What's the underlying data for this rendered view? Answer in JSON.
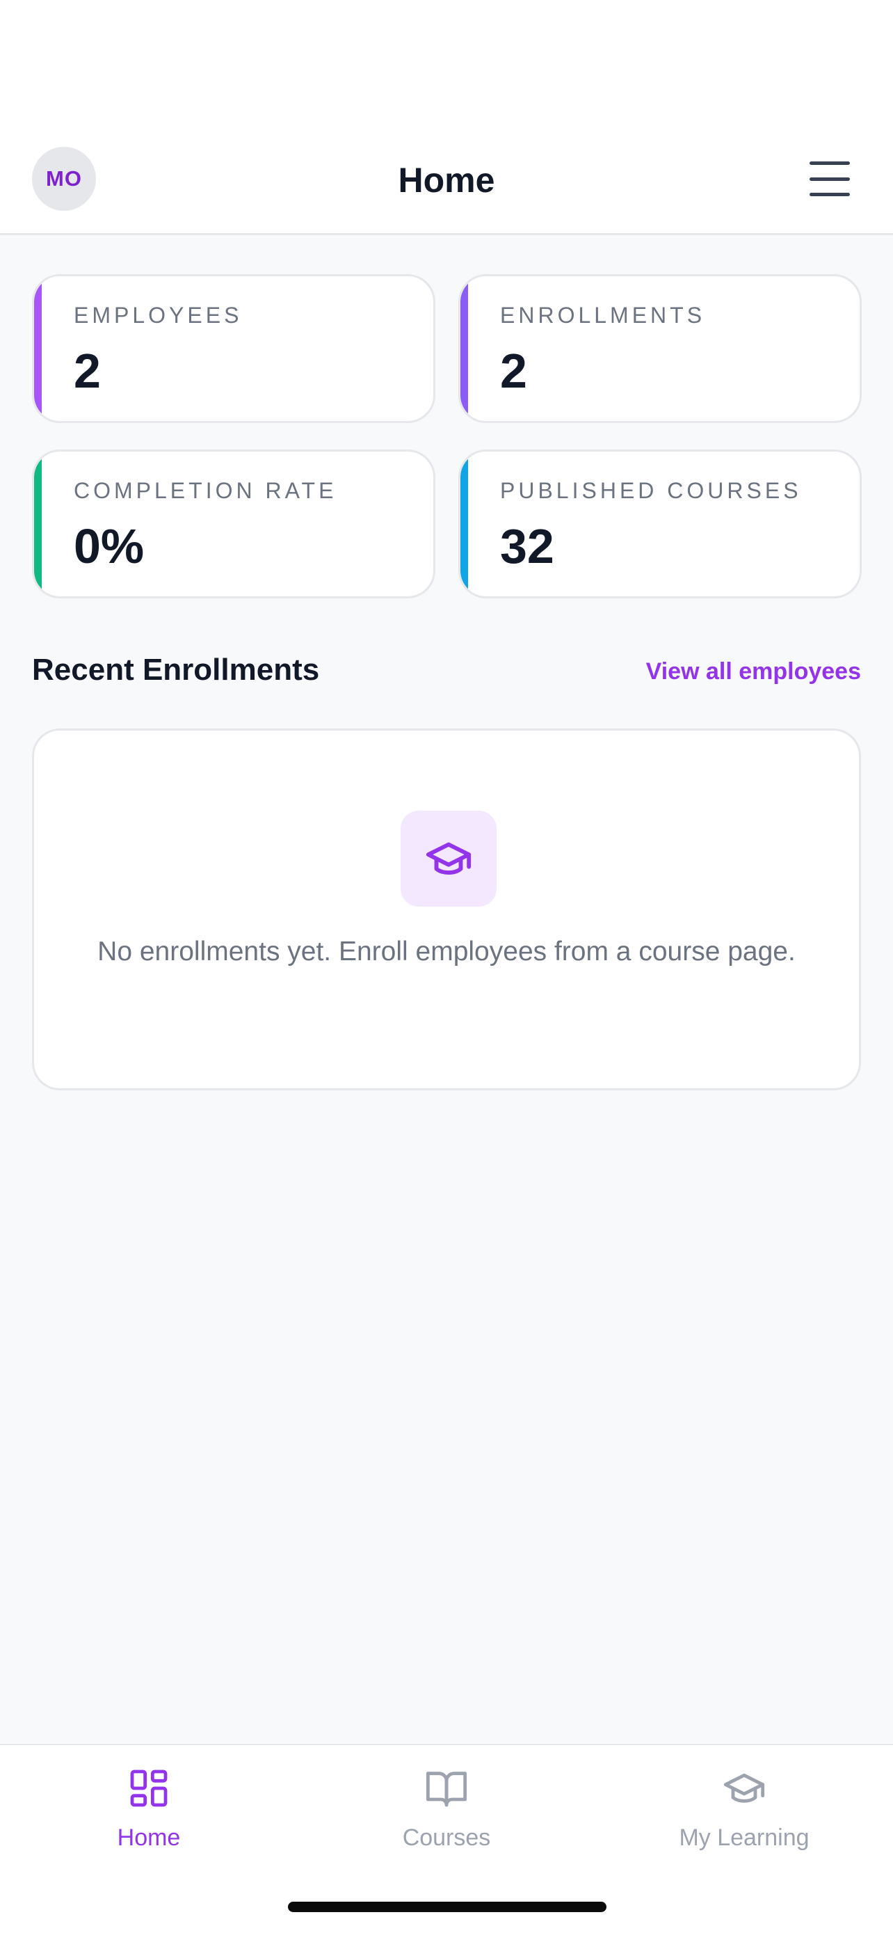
{
  "header": {
    "avatar_initials": "MO",
    "title": "Home",
    "menu_icon": "hamburger-menu-icon"
  },
  "stats": [
    {
      "label": "EMPLOYEES",
      "value": "2",
      "accent": "#A855F7"
    },
    {
      "label": "ENROLLMENTS",
      "value": "2",
      "accent": "#8B5CF6"
    },
    {
      "label": "COMPLETION RATE",
      "value": "0%",
      "accent": "#10B981"
    },
    {
      "label": "PUBLISHED COURSES",
      "value": "32",
      "accent": "#0EA5E9"
    }
  ],
  "recent": {
    "title": "Recent Enrollments",
    "view_all": "View all employees",
    "empty_icon": "graduation-cap-icon",
    "empty_text": "No enrollments yet. Enroll employees from a course page."
  },
  "nav": [
    {
      "label": "Home",
      "icon": "grid-icon",
      "active": true
    },
    {
      "label": "Courses",
      "icon": "book-icon",
      "active": false
    },
    {
      "label": "My Learning",
      "icon": "graduation-cap-icon",
      "active": false
    }
  ],
  "colors": {
    "brand": "#9333EA",
    "text": "#111827",
    "muted": "#6B7280",
    "inactive": "#9CA3AF",
    "background": "#F8F9FB"
  }
}
